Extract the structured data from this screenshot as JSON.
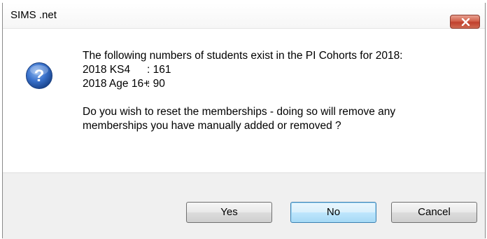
{
  "window": {
    "title": "SIMS .net"
  },
  "icon": {
    "name": "question-icon",
    "color": "#2a62b8"
  },
  "message": {
    "line1": "The following numbers of students exist in the PI Cohorts for 2018:",
    "cohort1_label": "2018 KS4",
    "cohort1_value": ": 161",
    "cohort2_label": "2018 Age 16+",
    "cohort2_value": ": 90",
    "question_line1": "Do you wish to reset the memberships - doing so will remove any",
    "question_line2": "memberships you have manually added or removed ?"
  },
  "buttons": {
    "yes": "Yes",
    "no": "No",
    "cancel": "Cancel",
    "default": "no"
  }
}
